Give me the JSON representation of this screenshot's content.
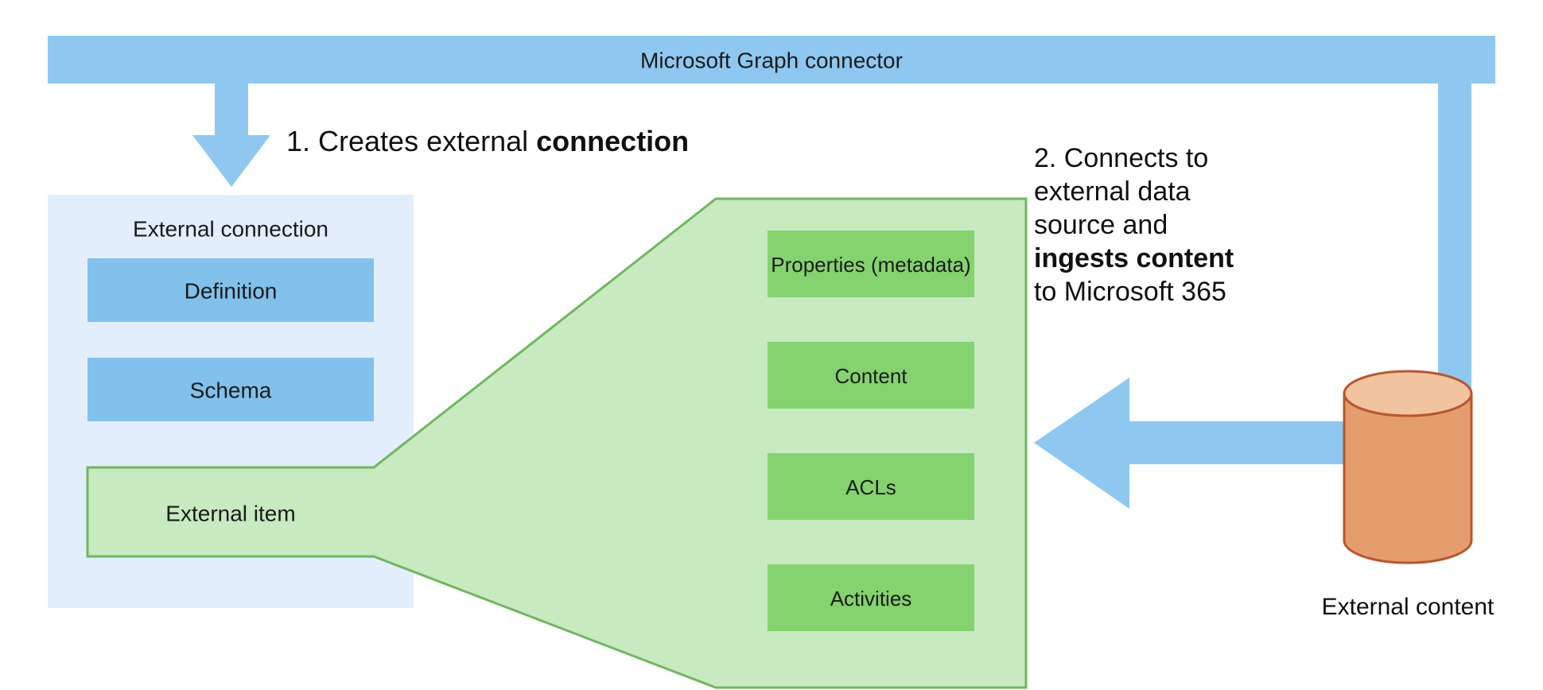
{
  "connector_bar": {
    "label": "Microsoft Graph connector"
  },
  "step1": {
    "prefix": "1. Creates external ",
    "bold": "connection"
  },
  "step2": {
    "line1": "2. Connects to",
    "line2": "external data",
    "line3": "source and",
    "bold": "ingests content",
    "line5": "to Microsoft 365"
  },
  "external_connection": {
    "title": "External connection",
    "definition": "Definition",
    "schema": "Schema",
    "external_item": "External item"
  },
  "item_detail": {
    "properties": "Properties (metadata)",
    "content": "Content",
    "acls": "ACLs",
    "activities": "Activities"
  },
  "external_content_label": "External content",
  "colors": {
    "blue_bar": "#8ec8f0",
    "blue_light": "#e3eefc",
    "blue_mid": "#81c1ec",
    "green_light": "#c7eac0",
    "green_mid": "#84d36e",
    "green_stroke": "#6fb75e",
    "cyl_fill": "#e69d6d",
    "cyl_top": "#f2c39f",
    "cyl_stroke": "#b8572f"
  }
}
